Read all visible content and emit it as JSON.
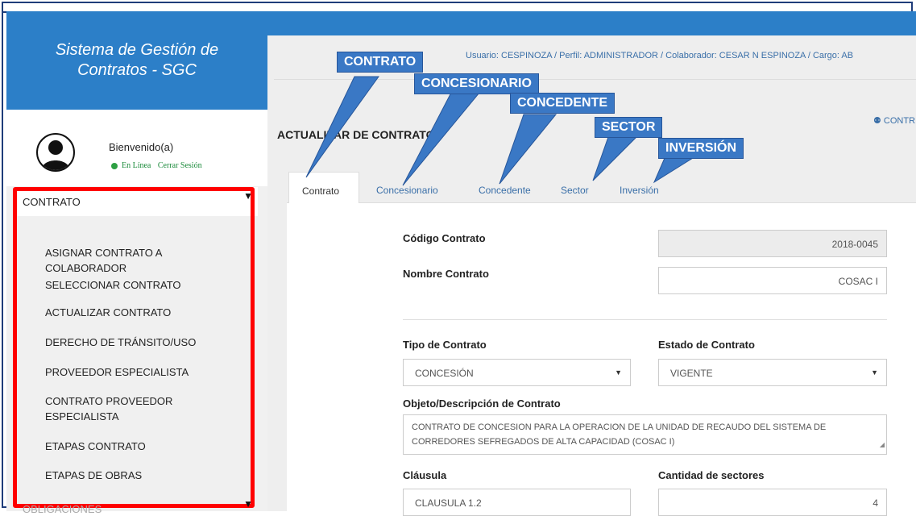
{
  "app": {
    "title": "Sistema de Gestión de Contratos - SGC"
  },
  "user": {
    "welcome": "Bienvenido(a)",
    "status": "En Línea",
    "logout": "Cerrar Sesión"
  },
  "sidebar": {
    "section": "CONTRATO",
    "items": [
      {
        "label": "ASIGNAR CONTRATO A COLABORADOR"
      },
      {
        "label": "SELECCIONAR CONTRATO"
      },
      {
        "label": "ACTUALIZAR CONTRATO"
      },
      {
        "label": "DERECHO DE TRÁNSITO/USO"
      },
      {
        "label": "PROVEEDOR ESPECIALISTA"
      },
      {
        "label": "CONTRATO PROVEEDOR ESPECIALISTA"
      },
      {
        "label": "ETAPAS CONTRATO"
      },
      {
        "label": "ETAPAS DE OBRAS"
      }
    ],
    "next_section": "OBLIGACIONES"
  },
  "header": {
    "user_line": "Usuario: CESPINOZA / Perfil: ADMINISTRADOR / Colaborador: CESAR N ESPINOZA / Cargo: AB",
    "page_title": "ACTUALIZAR DE CONTRATO",
    "top_link": "CONTR"
  },
  "tabs": [
    {
      "label": "Contrato"
    },
    {
      "label": "Concesionario"
    },
    {
      "label": "Concedente"
    },
    {
      "label": "Sector"
    },
    {
      "label": "Inversión"
    }
  ],
  "callouts": [
    "CONTRATO",
    "CONCESIONARIO",
    "CONCEDENTE",
    "SECTOR",
    "INVERSIÓN"
  ],
  "form": {
    "codigo_label": "Código Contrato",
    "codigo_value": "2018-0045",
    "nombre_label": "Nombre Contrato",
    "nombre_value": "COSAC I",
    "tipo_label": "Tipo de Contrato",
    "tipo_value": "CONCESIÓN",
    "estado_label": "Estado de Contrato",
    "estado_value": "VIGENTE",
    "objeto_label": "Objeto/Descripción de Contrato",
    "objeto_value": "CONTRATO DE CONCESION PARA LA OPERACION DE LA UNIDAD DE RECAUDO DEL SISTEMA DE CORREDORES SEFREGADOS DE ALTA CAPACIDAD (COSAC I)",
    "clausula_label": "Cláusula",
    "clausula_value": "CLAUSULA 1.2",
    "sectores_label": "Cantidad de sectores",
    "sectores_value": "4"
  },
  "colors": {
    "brand": "#2c7fc8",
    "callout": "#3a78c5",
    "highlight": "#ff0000"
  }
}
